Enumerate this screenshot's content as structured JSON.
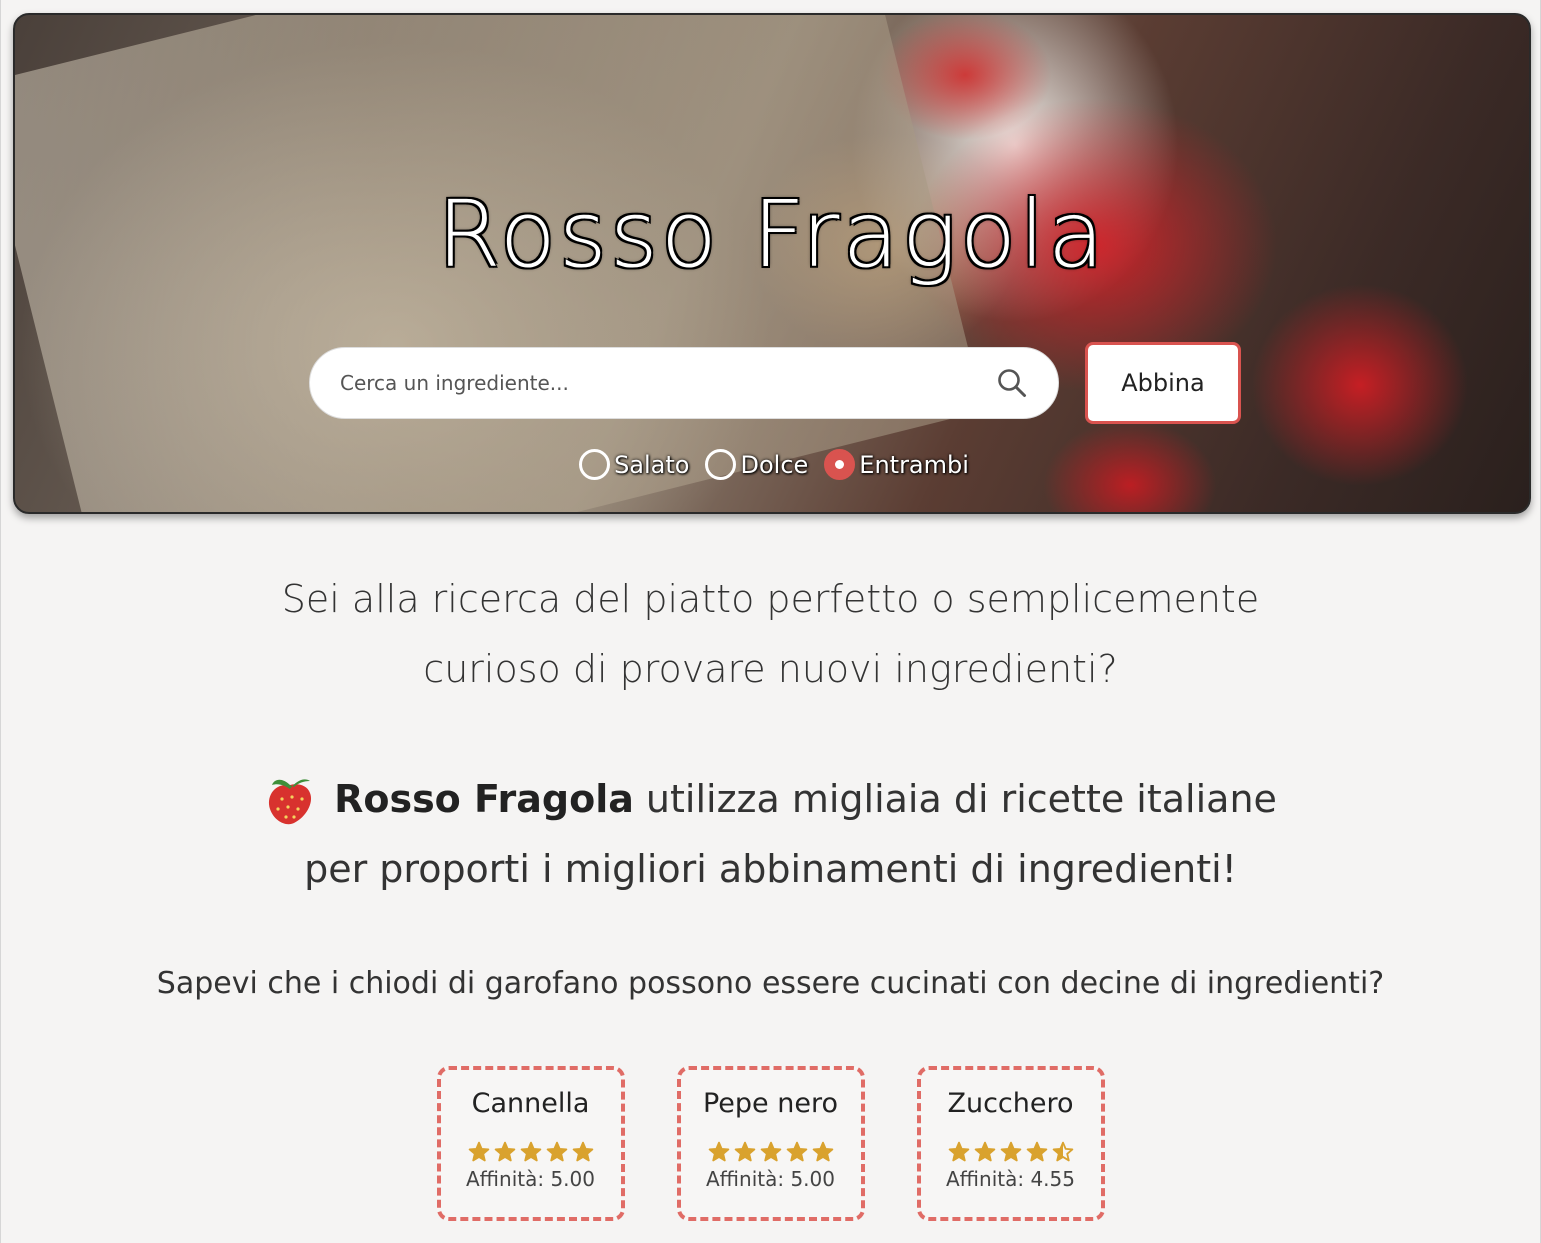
{
  "hero": {
    "title": "Rosso Fragola",
    "search_placeholder": "Cerca un ingrediente...",
    "match_label": "Abbina",
    "radio_options": [
      {
        "label": "Salato",
        "checked": false
      },
      {
        "label": "Dolce",
        "checked": false
      },
      {
        "label": "Entrambi",
        "checked": true
      }
    ]
  },
  "intro": {
    "line1": "Sei alla ricerca del piatto perfetto o semplicemente",
    "line2": "curioso di provare nuovi ingredienti?"
  },
  "brand": {
    "icon": "strawberry-icon",
    "name": "Rosso Fragola",
    "line1_rest": "utilizza migliaia di ricette italiane",
    "line2": "per proporti i migliori abbinamenti di ingredienti!"
  },
  "fact": "Sapevi che i chiodi di garofano possono essere cucinati con decine di ingredienti?",
  "cards": [
    {
      "name": "Cannella",
      "stars": 5,
      "score": "Affinità: 5.00"
    },
    {
      "name": "Pepe nero",
      "stars": 5,
      "score": "Affinità: 5.00"
    },
    {
      "name": "Zucchero",
      "stars": 4.5,
      "score": "Affinità: 4.55"
    }
  ],
  "colors": {
    "accent": "#d9534f",
    "card_border": "#e06c66",
    "star": "#d9a22e",
    "background": "#f5f4f3"
  }
}
